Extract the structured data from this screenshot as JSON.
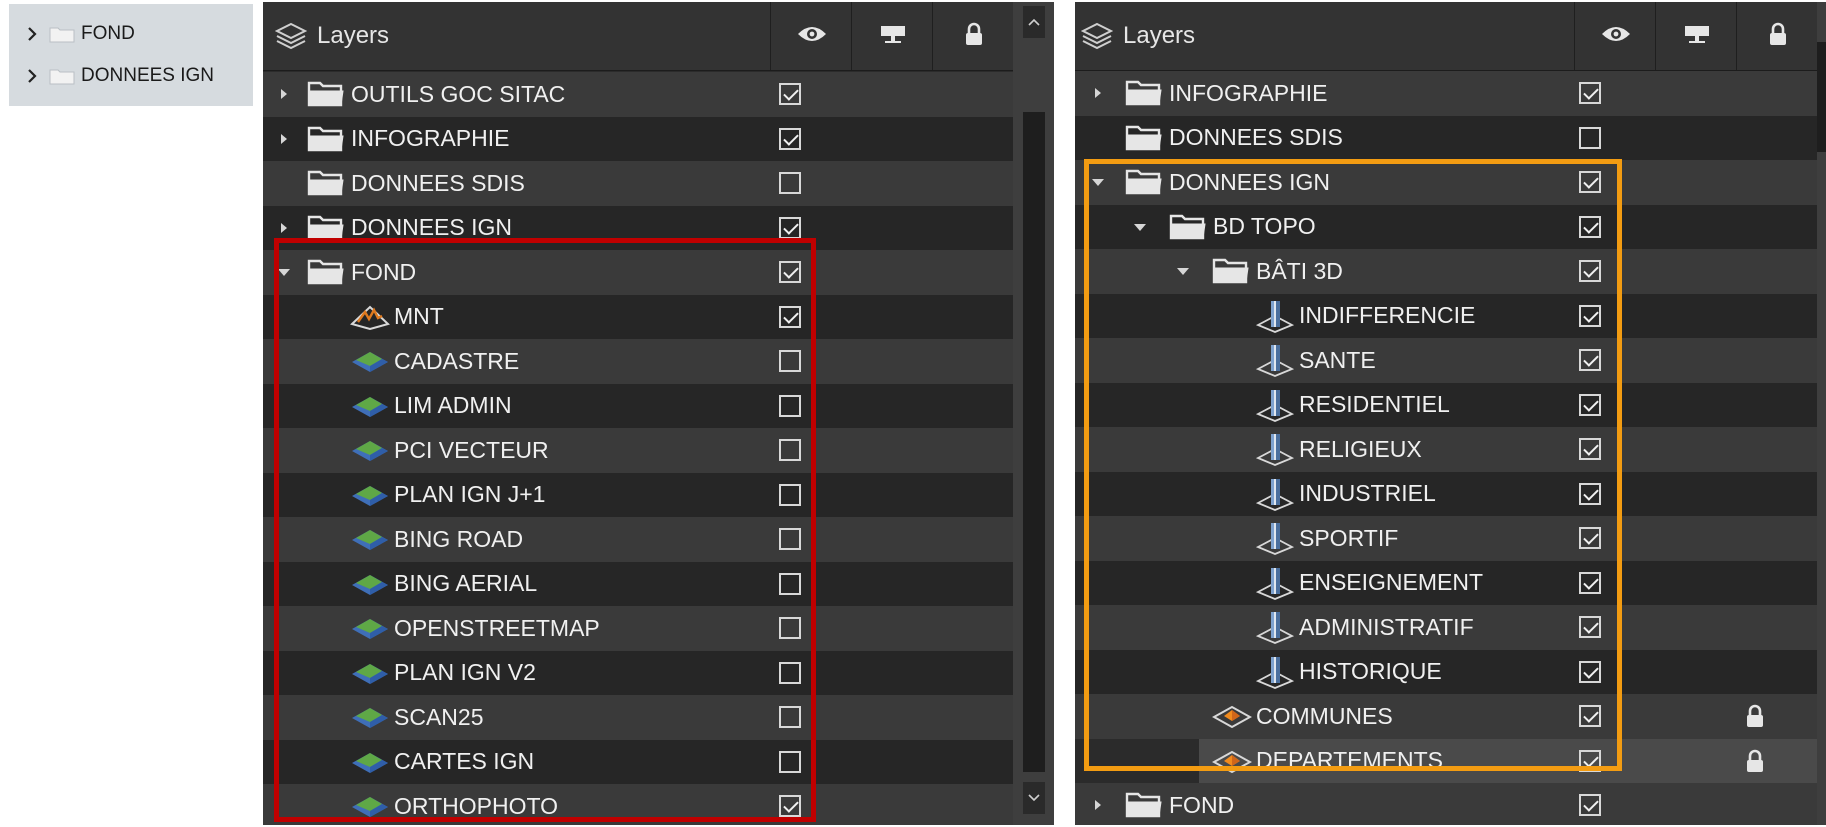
{
  "mini_tree": {
    "items": [
      {
        "label": "FOND"
      },
      {
        "label": "DONNEES IGN"
      }
    ]
  },
  "panel_left": {
    "title": "Layers",
    "rows": [
      {
        "label": "OUTILS GOC SITAC",
        "icon": "folder-icon",
        "arrow": "right",
        "checked": true
      },
      {
        "label": "INFOGRAPHIE",
        "icon": "folder-icon",
        "arrow": "right",
        "checked": true
      },
      {
        "label": "DONNEES SDIS",
        "icon": "folder-icon",
        "arrow": "none",
        "checked": false
      },
      {
        "label": "DONNEES IGN",
        "icon": "folder-icon",
        "arrow": "right",
        "checked": true
      },
      {
        "label": "FOND",
        "icon": "folder-icon",
        "arrow": "down",
        "checked": true
      },
      {
        "label": "MNT",
        "icon": "terrain-icon",
        "arrow": "none",
        "checked": true
      },
      {
        "label": "CADASTRE",
        "icon": "imagery-layer-icon",
        "arrow": "none",
        "checked": false
      },
      {
        "label": "LIM ADMIN",
        "icon": "imagery-layer-icon",
        "arrow": "none",
        "checked": false
      },
      {
        "label": "PCI VECTEUR",
        "icon": "imagery-layer-icon",
        "arrow": "none",
        "checked": false
      },
      {
        "label": "PLAN IGN J+1",
        "icon": "imagery-layer-icon",
        "arrow": "none",
        "checked": false
      },
      {
        "label": "BING ROAD",
        "icon": "imagery-layer-icon",
        "arrow": "none",
        "checked": false
      },
      {
        "label": "BING AERIAL",
        "icon": "imagery-layer-icon",
        "arrow": "none",
        "checked": false
      },
      {
        "label": "OPENSTREETMAP",
        "icon": "imagery-layer-icon",
        "arrow": "none",
        "checked": false
      },
      {
        "label": "PLAN IGN V2",
        "icon": "imagery-layer-icon",
        "arrow": "none",
        "checked": false
      },
      {
        "label": "SCAN25",
        "icon": "imagery-layer-icon",
        "arrow": "none",
        "checked": false
      },
      {
        "label": "CARTES IGN",
        "icon": "imagery-layer-icon",
        "arrow": "none",
        "checked": false
      },
      {
        "label": "ORTHOPHOTO",
        "icon": "imagery-layer-icon",
        "arrow": "none",
        "checked": true
      }
    ]
  },
  "panel_right": {
    "title": "Layers",
    "rows": [
      {
        "label": "INFOGRAPHIE",
        "icon": "folder-icon",
        "arrow": "right",
        "checked": true,
        "locked": false
      },
      {
        "label": "DONNEES SDIS",
        "icon": "folder-icon",
        "arrow": "none",
        "checked": false,
        "locked": false
      },
      {
        "label": "DONNEES IGN",
        "icon": "folder-icon",
        "arrow": "down",
        "checked": true,
        "locked": false
      },
      {
        "label": "BD TOPO",
        "icon": "folder-icon",
        "arrow": "down",
        "checked": true,
        "locked": false
      },
      {
        "label": "BÂTI 3D",
        "icon": "folder-icon",
        "arrow": "down",
        "checked": true,
        "locked": false
      },
      {
        "label": "INDIFFERENCIE",
        "icon": "building-3d-icon",
        "arrow": "none",
        "checked": true,
        "locked": false
      },
      {
        "label": "SANTE",
        "icon": "building-3d-icon",
        "arrow": "none",
        "checked": true,
        "locked": false
      },
      {
        "label": "RESIDENTIEL",
        "icon": "building-3d-icon",
        "arrow": "none",
        "checked": true,
        "locked": false
      },
      {
        "label": "RELIGIEUX",
        "icon": "building-3d-icon",
        "arrow": "none",
        "checked": true,
        "locked": false
      },
      {
        "label": "INDUSTRIEL",
        "icon": "building-3d-icon",
        "arrow": "none",
        "checked": true,
        "locked": false
      },
      {
        "label": "SPORTIF",
        "icon": "building-3d-icon",
        "arrow": "none",
        "checked": true,
        "locked": false
      },
      {
        "label": "ENSEIGNEMENT",
        "icon": "building-3d-icon",
        "arrow": "none",
        "checked": true,
        "locked": false
      },
      {
        "label": "ADMINISTRATIF",
        "icon": "building-3d-icon",
        "arrow": "none",
        "checked": true,
        "locked": false
      },
      {
        "label": "HISTORIQUE",
        "icon": "building-3d-icon",
        "arrow": "none",
        "checked": true,
        "locked": false
      },
      {
        "label": "COMMUNES",
        "icon": "vector-layer-icon",
        "arrow": "none",
        "checked": true,
        "locked": true
      },
      {
        "label": "DEPARTEMENTS",
        "icon": "vector-layer-icon",
        "arrow": "none",
        "checked": true,
        "locked": true,
        "selected": true
      },
      {
        "label": "FOND",
        "icon": "folder-icon",
        "arrow": "right",
        "checked": true,
        "locked": false
      }
    ]
  },
  "colors": {
    "left_highlight": "#c00000",
    "right_highlight": "#f39c12"
  }
}
